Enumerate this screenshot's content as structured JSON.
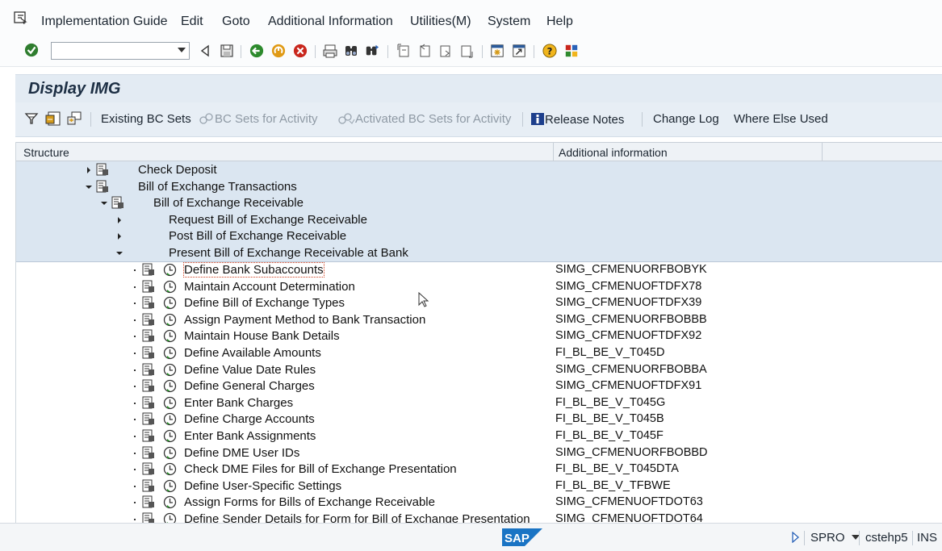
{
  "menu": {
    "items": [
      {
        "label": "Implementation Guide"
      },
      {
        "label": "Edit"
      },
      {
        "label": "Goto"
      },
      {
        "label": "Additional Information"
      },
      {
        "label": "Utilities(M)"
      },
      {
        "label": "System"
      },
      {
        "label": "Help"
      }
    ]
  },
  "toolbar": {
    "command_field_value": "",
    "icons": [
      "enter-check-icon",
      "back-triangle-icon",
      "save-icon",
      "back-icon",
      "exit-icon",
      "cancel-icon",
      "print-icon",
      "find-icon",
      "find-next-icon",
      "first-page-icon",
      "previous-page-icon",
      "next-page-icon",
      "last-page-icon",
      "create-session-icon",
      "shortcut-icon",
      "help-icon",
      "layout-icon"
    ]
  },
  "title": "Display IMG",
  "app_toolbar": {
    "existing_bc_sets": "Existing BC Sets",
    "bc_sets_for_activity": "BC Sets for Activity",
    "activated_bc_sets": "Activated BC Sets for Activity",
    "release_notes": "Release Notes",
    "change_log": "Change Log",
    "where_else_used": "Where Else Used"
  },
  "tree": {
    "col_structure": "Structure",
    "col_additional": "Additional information",
    "nodes": [
      {
        "label": "Check Deposit",
        "info": ""
      },
      {
        "label": "Bill of Exchange Transactions",
        "info": ""
      },
      {
        "label": "Bill of Exchange Receivable",
        "info": ""
      },
      {
        "label": "Request Bill of Exchange Receivable",
        "info": ""
      },
      {
        "label": "Post Bill of Exchange Receivable",
        "info": ""
      },
      {
        "label": "Present Bill of Exchange Receivable at Bank",
        "info": ""
      },
      {
        "label": "Define Bank Subaccounts",
        "info": "SIMG_CFMENUORFBOBYK"
      },
      {
        "label": "Maintain Account Determination",
        "info": "SIMG_CFMENUOFTDFX78"
      },
      {
        "label": "Define Bill of Exchange Types",
        "info": "SIMG_CFMENUOFTDFX39"
      },
      {
        "label": "Assign Payment Method to Bank Transaction",
        "info": "SIMG_CFMENUORFBOBBB"
      },
      {
        "label": "Maintain House Bank Details",
        "info": "SIMG_CFMENUOFTDFX92"
      },
      {
        "label": "Define Available Amounts",
        "info": "FI_BL_BE_V_T045D"
      },
      {
        "label": "Define Value Date Rules",
        "info": "SIMG_CFMENUORFBOBBA"
      },
      {
        "label": "Define General Charges",
        "info": "SIMG_CFMENUOFTDFX91"
      },
      {
        "label": "Enter Bank Charges",
        "info": "FI_BL_BE_V_T045G"
      },
      {
        "label": "Define Charge Accounts",
        "info": "FI_BL_BE_V_T045B"
      },
      {
        "label": "Enter Bank Assignments",
        "info": "FI_BL_BE_V_T045F"
      },
      {
        "label": "Define DME User IDs",
        "info": "SIMG_CFMENUORFBOBBD"
      },
      {
        "label": "Check DME Files for Bill of Exchange Presentation",
        "info": "FI_BL_BE_V_T045DTA"
      },
      {
        "label": "Define User-Specific Settings",
        "info": "FI_BL_BE_V_TFBWE"
      },
      {
        "label": "Assign Forms for Bills of Exchange Receivable",
        "info": "SIMG_CFMENUOFTDOT63"
      },
      {
        "label": "Define Sender Details for Form for Bill of Exchange Presentation",
        "info": "SIMG_CFMENUOFTDOT64"
      }
    ]
  },
  "status": {
    "logo": "SAP",
    "transaction": "SPRO",
    "server": "cstehp5",
    "mode": "INS"
  },
  "colors": {
    "highlight_row": "#dbe6f1",
    "title_bg": "#e3ebf3",
    "sap_blue": "#1a74c4"
  }
}
